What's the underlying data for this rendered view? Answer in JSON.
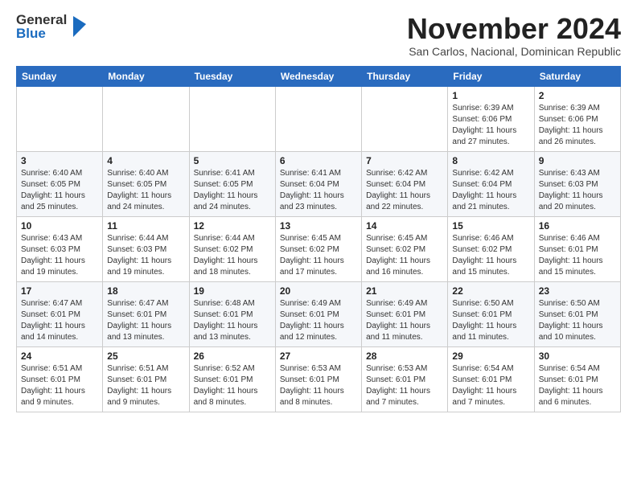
{
  "header": {
    "logo_general": "General",
    "logo_blue": "Blue",
    "month_title": "November 2024",
    "location": "San Carlos, Nacional, Dominican Republic"
  },
  "weekdays": [
    "Sunday",
    "Monday",
    "Tuesday",
    "Wednesday",
    "Thursday",
    "Friday",
    "Saturday"
  ],
  "weeks": [
    [
      {
        "day": "",
        "info": ""
      },
      {
        "day": "",
        "info": ""
      },
      {
        "day": "",
        "info": ""
      },
      {
        "day": "",
        "info": ""
      },
      {
        "day": "",
        "info": ""
      },
      {
        "day": "1",
        "info": "Sunrise: 6:39 AM\nSunset: 6:06 PM\nDaylight: 11 hours\nand 27 minutes."
      },
      {
        "day": "2",
        "info": "Sunrise: 6:39 AM\nSunset: 6:06 PM\nDaylight: 11 hours\nand 26 minutes."
      }
    ],
    [
      {
        "day": "3",
        "info": "Sunrise: 6:40 AM\nSunset: 6:05 PM\nDaylight: 11 hours\nand 25 minutes."
      },
      {
        "day": "4",
        "info": "Sunrise: 6:40 AM\nSunset: 6:05 PM\nDaylight: 11 hours\nand 24 minutes."
      },
      {
        "day": "5",
        "info": "Sunrise: 6:41 AM\nSunset: 6:05 PM\nDaylight: 11 hours\nand 24 minutes."
      },
      {
        "day": "6",
        "info": "Sunrise: 6:41 AM\nSunset: 6:04 PM\nDaylight: 11 hours\nand 23 minutes."
      },
      {
        "day": "7",
        "info": "Sunrise: 6:42 AM\nSunset: 6:04 PM\nDaylight: 11 hours\nand 22 minutes."
      },
      {
        "day": "8",
        "info": "Sunrise: 6:42 AM\nSunset: 6:04 PM\nDaylight: 11 hours\nand 21 minutes."
      },
      {
        "day": "9",
        "info": "Sunrise: 6:43 AM\nSunset: 6:03 PM\nDaylight: 11 hours\nand 20 minutes."
      }
    ],
    [
      {
        "day": "10",
        "info": "Sunrise: 6:43 AM\nSunset: 6:03 PM\nDaylight: 11 hours\nand 19 minutes."
      },
      {
        "day": "11",
        "info": "Sunrise: 6:44 AM\nSunset: 6:03 PM\nDaylight: 11 hours\nand 19 minutes."
      },
      {
        "day": "12",
        "info": "Sunrise: 6:44 AM\nSunset: 6:02 PM\nDaylight: 11 hours\nand 18 minutes."
      },
      {
        "day": "13",
        "info": "Sunrise: 6:45 AM\nSunset: 6:02 PM\nDaylight: 11 hours\nand 17 minutes."
      },
      {
        "day": "14",
        "info": "Sunrise: 6:45 AM\nSunset: 6:02 PM\nDaylight: 11 hours\nand 16 minutes."
      },
      {
        "day": "15",
        "info": "Sunrise: 6:46 AM\nSunset: 6:02 PM\nDaylight: 11 hours\nand 15 minutes."
      },
      {
        "day": "16",
        "info": "Sunrise: 6:46 AM\nSunset: 6:01 PM\nDaylight: 11 hours\nand 15 minutes."
      }
    ],
    [
      {
        "day": "17",
        "info": "Sunrise: 6:47 AM\nSunset: 6:01 PM\nDaylight: 11 hours\nand 14 minutes."
      },
      {
        "day": "18",
        "info": "Sunrise: 6:47 AM\nSunset: 6:01 PM\nDaylight: 11 hours\nand 13 minutes."
      },
      {
        "day": "19",
        "info": "Sunrise: 6:48 AM\nSunset: 6:01 PM\nDaylight: 11 hours\nand 13 minutes."
      },
      {
        "day": "20",
        "info": "Sunrise: 6:49 AM\nSunset: 6:01 PM\nDaylight: 11 hours\nand 12 minutes."
      },
      {
        "day": "21",
        "info": "Sunrise: 6:49 AM\nSunset: 6:01 PM\nDaylight: 11 hours\nand 11 minutes."
      },
      {
        "day": "22",
        "info": "Sunrise: 6:50 AM\nSunset: 6:01 PM\nDaylight: 11 hours\nand 11 minutes."
      },
      {
        "day": "23",
        "info": "Sunrise: 6:50 AM\nSunset: 6:01 PM\nDaylight: 11 hours\nand 10 minutes."
      }
    ],
    [
      {
        "day": "24",
        "info": "Sunrise: 6:51 AM\nSunset: 6:01 PM\nDaylight: 11 hours\nand 9 minutes."
      },
      {
        "day": "25",
        "info": "Sunrise: 6:51 AM\nSunset: 6:01 PM\nDaylight: 11 hours\nand 9 minutes."
      },
      {
        "day": "26",
        "info": "Sunrise: 6:52 AM\nSunset: 6:01 PM\nDaylight: 11 hours\nand 8 minutes."
      },
      {
        "day": "27",
        "info": "Sunrise: 6:53 AM\nSunset: 6:01 PM\nDaylight: 11 hours\nand 8 minutes."
      },
      {
        "day": "28",
        "info": "Sunrise: 6:53 AM\nSunset: 6:01 PM\nDaylight: 11 hours\nand 7 minutes."
      },
      {
        "day": "29",
        "info": "Sunrise: 6:54 AM\nSunset: 6:01 PM\nDaylight: 11 hours\nand 7 minutes."
      },
      {
        "day": "30",
        "info": "Sunrise: 6:54 AM\nSunset: 6:01 PM\nDaylight: 11 hours\nand 6 minutes."
      }
    ]
  ]
}
